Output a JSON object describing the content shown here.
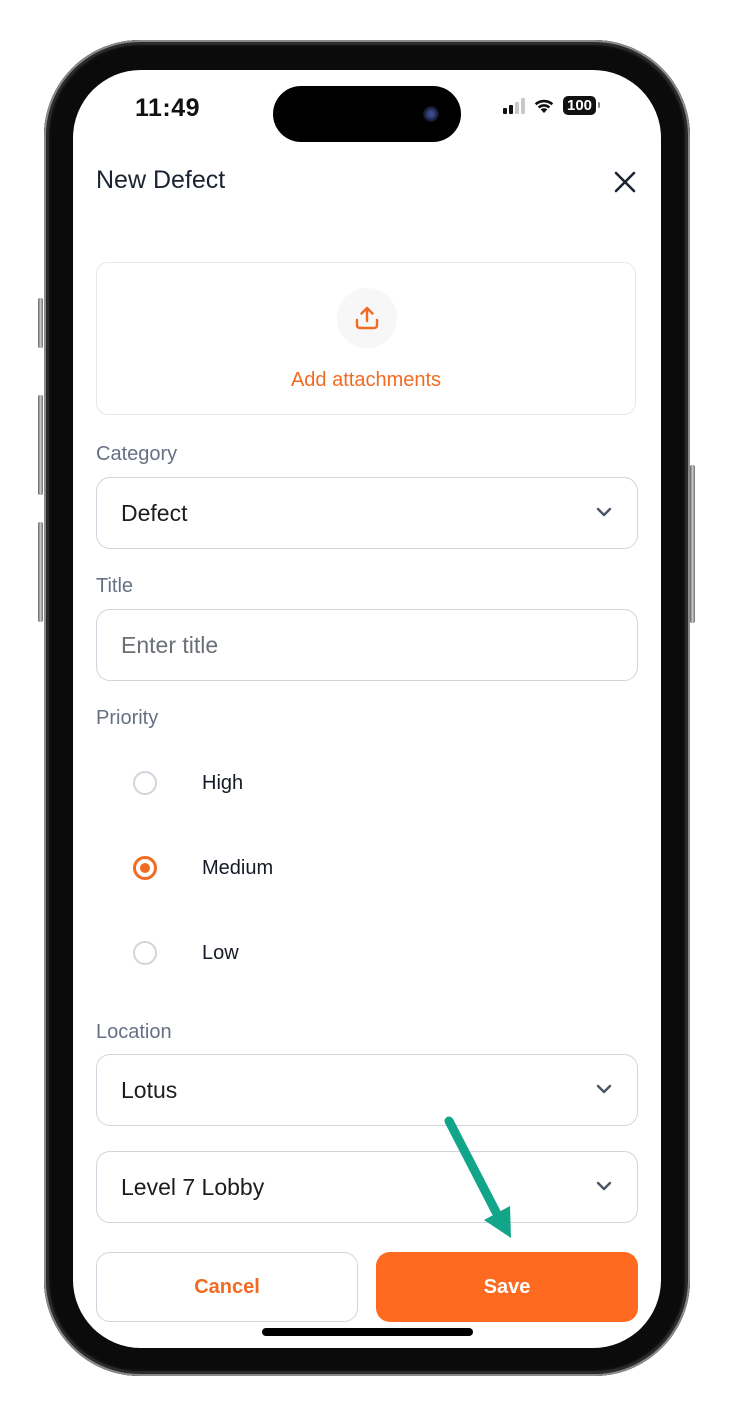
{
  "status_bar": {
    "time": "11:49",
    "battery": "100",
    "signal_icon": "cellular-signal-icon",
    "wifi_icon": "wifi-icon"
  },
  "header": {
    "title": "New Defect",
    "close_icon": "close-icon"
  },
  "attachments": {
    "icon": "upload-icon",
    "label": "Add attachments"
  },
  "category": {
    "label": "Category",
    "value": "Defect"
  },
  "title_field": {
    "label": "Title",
    "placeholder": "Enter title",
    "value": ""
  },
  "priority": {
    "label": "Priority",
    "options": [
      {
        "label": "High",
        "selected": false
      },
      {
        "label": "Medium",
        "selected": true
      },
      {
        "label": "Low",
        "selected": false
      }
    ]
  },
  "location": {
    "label": "Location",
    "site": "Lotus",
    "area": "Level 7 Lobby"
  },
  "actions": {
    "cancel_label": "Cancel",
    "save_label": "Save"
  },
  "colors": {
    "accent": "#ff6a21",
    "accent_text": "#f26b22",
    "annotation_arrow": "#13a589",
    "label": "#667085",
    "border": "#d0d5dd"
  }
}
